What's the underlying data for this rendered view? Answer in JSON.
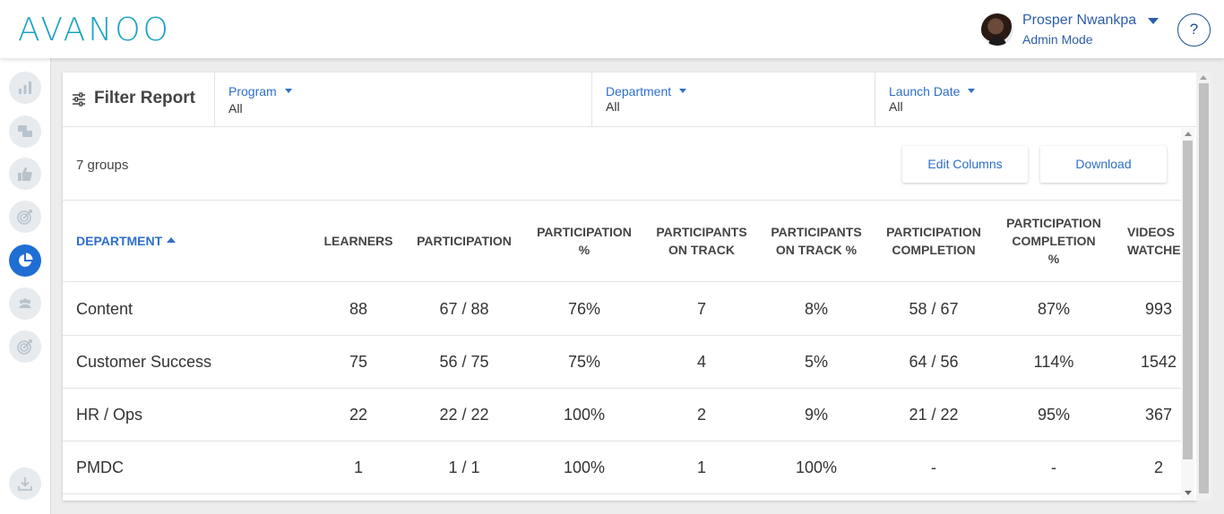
{
  "header": {
    "logo": "AVANOO",
    "user_name": "Prosper Nwankpa",
    "user_mode": "Admin Mode",
    "help": "?"
  },
  "sidebar": {
    "items": [
      {
        "icon": "bar-chart-icon"
      },
      {
        "icon": "chat-bubbles-icon"
      },
      {
        "icon": "thumbs-up-icon"
      },
      {
        "icon": "target-icon"
      },
      {
        "icon": "pie-chart-icon",
        "active": true
      },
      {
        "icon": "group-icon"
      },
      {
        "icon": "target-icon"
      },
      {
        "icon": "download-icon"
      }
    ]
  },
  "filters": {
    "title": "Filter Report",
    "items": [
      {
        "label": "Program",
        "value": "All"
      },
      {
        "label": "Department",
        "value": "All"
      },
      {
        "label": "Launch Date",
        "value": "All"
      }
    ]
  },
  "toolbar": {
    "group_count": "7 groups",
    "edit_columns": "Edit Columns",
    "download": "Download"
  },
  "table": {
    "columns": [
      "DEPARTMENT",
      "LEARNERS",
      "PARTICIPATION",
      "PARTICIPATION %",
      "PARTICIPANTS ON TRACK",
      "PARTICIPANTS ON TRACK %",
      "PARTICIPATION COMPLETION",
      "PARTICIPATION COMPLETION %",
      "VIDEOS WATCHE"
    ],
    "header_lines": [
      [
        "DEPARTMENT"
      ],
      [
        "LEARNERS"
      ],
      [
        "PARTICIPATION"
      ],
      [
        "PARTICIPATION",
        "%"
      ],
      [
        "PARTICIPANTS",
        "ON TRACK"
      ],
      [
        "PARTICIPANTS",
        "ON TRACK %"
      ],
      [
        "PARTICIPATION",
        "COMPLETION"
      ],
      [
        "PARTICIPATION",
        "COMPLETION",
        "%"
      ],
      [
        "VIDEOS",
        "WATCHE"
      ]
    ],
    "rows": [
      [
        "Content",
        "88",
        "67 / 88",
        "76%",
        "7",
        "8%",
        "58 / 67",
        "87%",
        "993"
      ],
      [
        "Customer Success",
        "75",
        "56 / 75",
        "75%",
        "4",
        "5%",
        "64 / 56",
        "114%",
        "1542"
      ],
      [
        "HR / Ops",
        "22",
        "22 / 22",
        "100%",
        "2",
        "9%",
        "21 / 22",
        "95%",
        "367"
      ],
      [
        "PMDC",
        "1",
        "1 / 1",
        "100%",
        "1",
        "100%",
        "-",
        "-",
        "2"
      ]
    ]
  }
}
